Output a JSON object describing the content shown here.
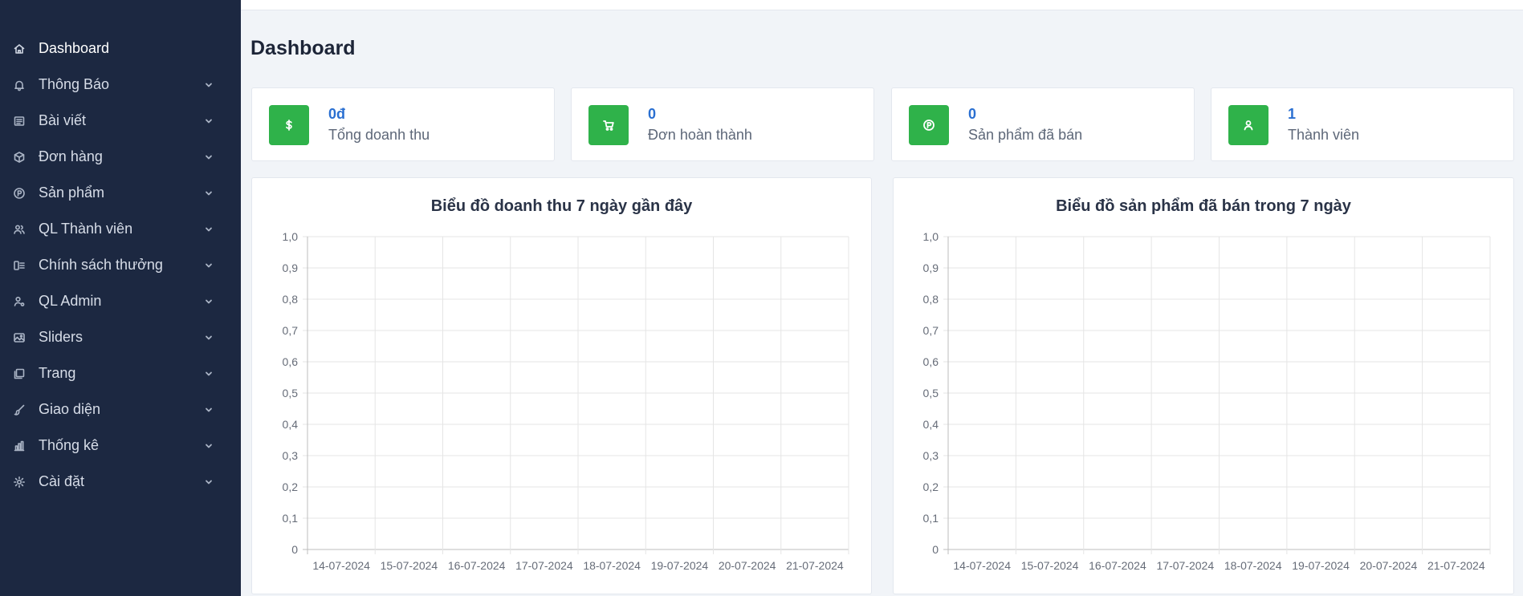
{
  "sidebar": {
    "items": [
      {
        "label": "Dashboard",
        "icon": "home-icon",
        "active": true,
        "chevron": false
      },
      {
        "label": "Thông Báo",
        "icon": "bell-icon",
        "active": false,
        "chevron": true
      },
      {
        "label": "Bài viết",
        "icon": "document-icon",
        "active": false,
        "chevron": true
      },
      {
        "label": "Đơn hàng",
        "icon": "box-icon",
        "active": false,
        "chevron": true
      },
      {
        "label": "Sản phẩm",
        "icon": "product-circle-icon",
        "active": false,
        "chevron": true
      },
      {
        "label": "QL Thành viên",
        "icon": "users-icon",
        "active": false,
        "chevron": true
      },
      {
        "label": "Chính sách thưởng",
        "icon": "coins-icon",
        "active": false,
        "chevron": true
      },
      {
        "label": "QL Admin",
        "icon": "user-cog-icon",
        "active": false,
        "chevron": true
      },
      {
        "label": "Sliders",
        "icon": "image-icon",
        "active": false,
        "chevron": true
      },
      {
        "label": "Trang",
        "icon": "pages-icon",
        "active": false,
        "chevron": true
      },
      {
        "label": "Giao diện",
        "icon": "brush-icon",
        "active": false,
        "chevron": true
      },
      {
        "label": "Thống kê",
        "icon": "bar-chart-icon",
        "active": false,
        "chevron": true
      },
      {
        "label": "Cài đặt",
        "icon": "gear-icon",
        "active": false,
        "chevron": true
      }
    ]
  },
  "page": {
    "title": "Dashboard"
  },
  "colors": {
    "sidebar_bg": "#1c2841",
    "accent_green": "#2fb24a",
    "value_blue": "#2a6fd1",
    "page_bg": "#f1f4f8"
  },
  "stats": [
    {
      "value": "0đ",
      "label": "Tổng doanh thu",
      "icon": "dollar-icon"
    },
    {
      "value": "0",
      "label": "Đơn hoàn thành",
      "icon": "cart-icon"
    },
    {
      "value": "0",
      "label": "Sản phẩm đã bán",
      "icon": "product-circle-icon"
    },
    {
      "value": "1",
      "label": "Thành viên",
      "icon": "user-icon"
    }
  ],
  "chart_data": [
    {
      "type": "line",
      "title": "Biểu đồ doanh thu 7 ngày gần đây",
      "x": [
        "14-07-2024",
        "15-07-2024",
        "16-07-2024",
        "17-07-2024",
        "18-07-2024",
        "19-07-2024",
        "20-07-2024",
        "21-07-2024"
      ],
      "series": [],
      "yticks": [
        "0",
        "0,1",
        "0,2",
        "0,3",
        "0,4",
        "0,5",
        "0,6",
        "0,7",
        "0,8",
        "0,9",
        "1,0"
      ],
      "ylim": [
        0,
        1
      ],
      "grid": true
    },
    {
      "type": "line",
      "title": "Biểu đồ sản phẩm đã bán trong 7 ngày",
      "x": [
        "14-07-2024",
        "15-07-2024",
        "16-07-2024",
        "17-07-2024",
        "18-07-2024",
        "19-07-2024",
        "20-07-2024",
        "21-07-2024"
      ],
      "series": [],
      "yticks": [
        "0",
        "0,1",
        "0,2",
        "0,3",
        "0,4",
        "0,5",
        "0,6",
        "0,7",
        "0,8",
        "0,9",
        "1,0"
      ],
      "ylim": [
        0,
        1
      ],
      "grid": true
    }
  ]
}
